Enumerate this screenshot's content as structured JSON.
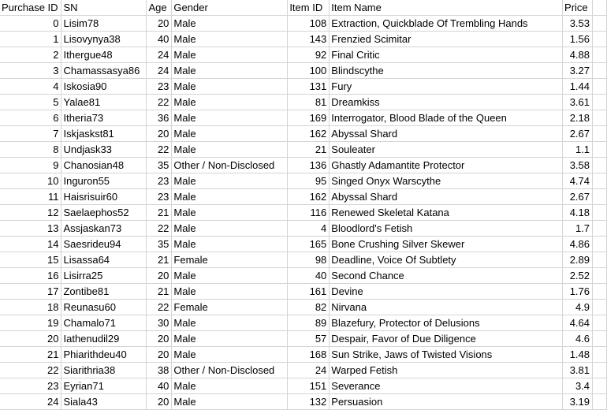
{
  "sheet": {
    "headers": [
      "Purchase ID",
      "SN",
      "Age",
      "Gender",
      "Item ID",
      "Item Name",
      "Price"
    ],
    "rows": [
      {
        "purchase_id": "0",
        "sn": "Lisim78",
        "age": "20",
        "gender": "Male",
        "item_id": "108",
        "item_name": "Extraction, Quickblade Of Trembling Hands",
        "price": "3.53"
      },
      {
        "purchase_id": "1",
        "sn": "Lisovynya38",
        "age": "40",
        "gender": "Male",
        "item_id": "143",
        "item_name": "Frenzied Scimitar",
        "price": "1.56"
      },
      {
        "purchase_id": "2",
        "sn": "Ithergue48",
        "age": "24",
        "gender": "Male",
        "item_id": "92",
        "item_name": "Final Critic",
        "price": "4.88"
      },
      {
        "purchase_id": "3",
        "sn": "Chamassasya86",
        "age": "24",
        "gender": "Male",
        "item_id": "100",
        "item_name": "Blindscythe",
        "price": "3.27"
      },
      {
        "purchase_id": "4",
        "sn": "Iskosia90",
        "age": "23",
        "gender": "Male",
        "item_id": "131",
        "item_name": "Fury",
        "price": "1.44"
      },
      {
        "purchase_id": "5",
        "sn": "Yalae81",
        "age": "22",
        "gender": "Male",
        "item_id": "81",
        "item_name": "Dreamkiss",
        "price": "3.61"
      },
      {
        "purchase_id": "6",
        "sn": "Itheria73",
        "age": "36",
        "gender": "Male",
        "item_id": "169",
        "item_name": "Interrogator, Blood Blade of the Queen",
        "price": "2.18"
      },
      {
        "purchase_id": "7",
        "sn": "Iskjaskst81",
        "age": "20",
        "gender": "Male",
        "item_id": "162",
        "item_name": "Abyssal Shard",
        "price": "2.67"
      },
      {
        "purchase_id": "8",
        "sn": "Undjask33",
        "age": "22",
        "gender": "Male",
        "item_id": "21",
        "item_name": "Souleater",
        "price": "1.1"
      },
      {
        "purchase_id": "9",
        "sn": "Chanosian48",
        "age": "35",
        "gender": "Other / Non-Disclosed",
        "item_id": "136",
        "item_name": "Ghastly Adamantite Protector",
        "price": "3.58"
      },
      {
        "purchase_id": "10",
        "sn": "Inguron55",
        "age": "23",
        "gender": "Male",
        "item_id": "95",
        "item_name": "Singed Onyx Warscythe",
        "price": "4.74"
      },
      {
        "purchase_id": "11",
        "sn": "Haisrisuir60",
        "age": "23",
        "gender": "Male",
        "item_id": "162",
        "item_name": "Abyssal Shard",
        "price": "2.67"
      },
      {
        "purchase_id": "12",
        "sn": "Saelaephos52",
        "age": "21",
        "gender": "Male",
        "item_id": "116",
        "item_name": "Renewed Skeletal Katana",
        "price": "4.18"
      },
      {
        "purchase_id": "13",
        "sn": "Assjaskan73",
        "age": "22",
        "gender": "Male",
        "item_id": "4",
        "item_name": "Bloodlord's Fetish",
        "price": "1.7"
      },
      {
        "purchase_id": "14",
        "sn": "Saesrideu94",
        "age": "35",
        "gender": "Male",
        "item_id": "165",
        "item_name": "Bone Crushing Silver Skewer",
        "price": "4.86"
      },
      {
        "purchase_id": "15",
        "sn": "Lisassa64",
        "age": "21",
        "gender": "Female",
        "item_id": "98",
        "item_name": "Deadline, Voice Of Subtlety",
        "price": "2.89"
      },
      {
        "purchase_id": "16",
        "sn": "Lisirra25",
        "age": "20",
        "gender": "Male",
        "item_id": "40",
        "item_name": "Second Chance",
        "price": "2.52"
      },
      {
        "purchase_id": "17",
        "sn": "Zontibe81",
        "age": "21",
        "gender": "Male",
        "item_id": "161",
        "item_name": "Devine",
        "price": "1.76"
      },
      {
        "purchase_id": "18",
        "sn": "Reunasu60",
        "age": "22",
        "gender": "Female",
        "item_id": "82",
        "item_name": "Nirvana",
        "price": "4.9"
      },
      {
        "purchase_id": "19",
        "sn": "Chamalo71",
        "age": "30",
        "gender": "Male",
        "item_id": "89",
        "item_name": "Blazefury, Protector of Delusions",
        "price": "4.64"
      },
      {
        "purchase_id": "20",
        "sn": "Iathenudil29",
        "age": "20",
        "gender": "Male",
        "item_id": "57",
        "item_name": "Despair, Favor of Due Diligence",
        "price": "4.6"
      },
      {
        "purchase_id": "21",
        "sn": "Phiarithdeu40",
        "age": "20",
        "gender": "Male",
        "item_id": "168",
        "item_name": "Sun Strike, Jaws of Twisted Visions",
        "price": "1.48"
      },
      {
        "purchase_id": "22",
        "sn": "Siarithria38",
        "age": "38",
        "gender": "Other / Non-Disclosed",
        "item_id": "24",
        "item_name": "Warped Fetish",
        "price": "3.81"
      },
      {
        "purchase_id": "23",
        "sn": "Eyrian71",
        "age": "40",
        "gender": "Male",
        "item_id": "151",
        "item_name": "Severance",
        "price": "3.4"
      },
      {
        "purchase_id": "24",
        "sn": "Siala43",
        "age": "20",
        "gender": "Male",
        "item_id": "132",
        "item_name": "Persuasion",
        "price": "3.19"
      }
    ]
  }
}
